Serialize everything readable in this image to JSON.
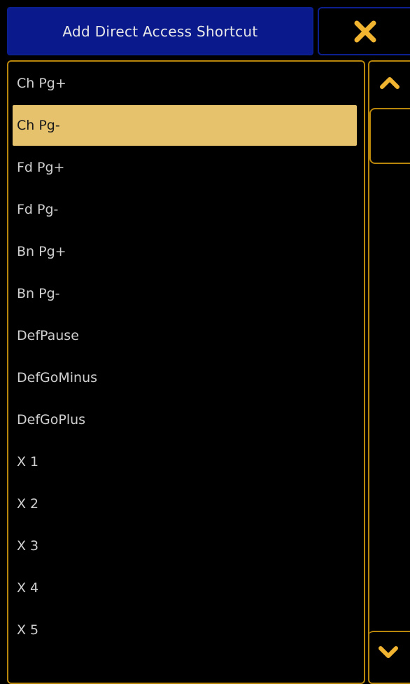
{
  "dialog": {
    "title": "Add Direct Access Shortcut"
  },
  "close_button": {
    "icon": "close-icon",
    "color": "#f0b430"
  },
  "list": {
    "selected_index": 1,
    "items": [
      {
        "label": "Ch Pg+"
      },
      {
        "label": "Ch Pg-"
      },
      {
        "label": "Fd Pg+"
      },
      {
        "label": "Fd Pg-"
      },
      {
        "label": "Bn Pg+"
      },
      {
        "label": "Bn Pg-"
      },
      {
        "label": "DefPause"
      },
      {
        "label": "DefGoMinus"
      },
      {
        "label": "DefGoPlus"
      },
      {
        "label": "X 1"
      },
      {
        "label": "X 2"
      },
      {
        "label": "X 3"
      },
      {
        "label": "X 4"
      },
      {
        "label": "X 5"
      }
    ]
  },
  "scrollbar": {
    "up_icon": "chevron-up-icon",
    "down_icon": "chevron-down-icon",
    "accent_color": "#f0b430"
  },
  "colors": {
    "title_bar_bg": "#0a1a8c",
    "border_accent": "#b8860b",
    "selected_bg": "#e6c26c"
  }
}
